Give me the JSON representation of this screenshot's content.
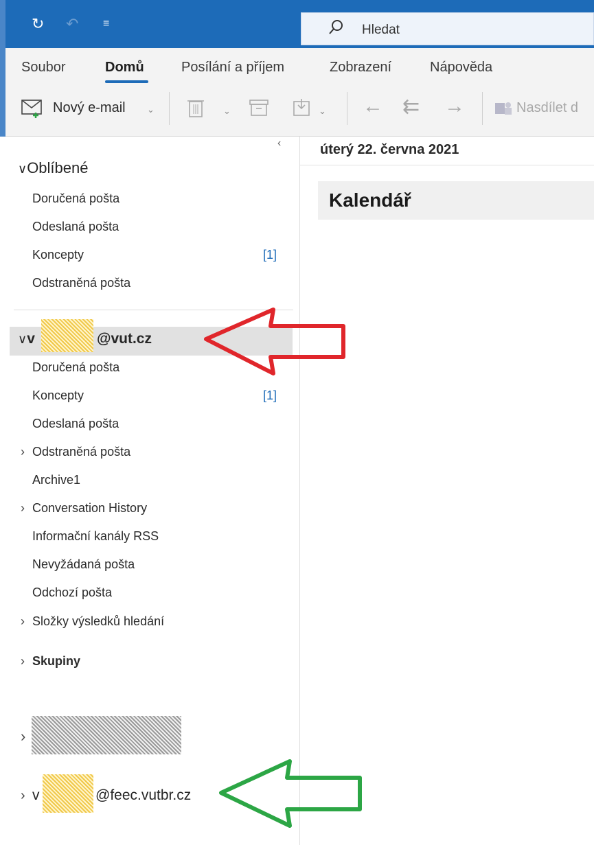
{
  "search": {
    "placeholder": "Hledat"
  },
  "ribbon": {
    "tabs": [
      "Soubor",
      "Domů",
      "Posílání a příjem",
      "Zobrazení",
      "Nápověda"
    ],
    "active_tab": "Domů",
    "new_email": "Nový e-mail",
    "share": "Nasdílet d"
  },
  "favorites": {
    "header": "Oblíbené",
    "items": [
      {
        "label": "Doručená pošta"
      },
      {
        "label": "Odeslaná pošta"
      },
      {
        "label": "Koncepty",
        "count": "[1]"
      },
      {
        "label": "Odstraněná pošta"
      }
    ]
  },
  "account1": {
    "prefix": "v",
    "suffix": "@vut.cz",
    "items": [
      {
        "label": "Doručená pošta"
      },
      {
        "label": "Koncepty",
        "count": "[1]"
      },
      {
        "label": "Odeslaná pošta"
      },
      {
        "label": "Odstraněná pošta",
        "expandable": true
      },
      {
        "label": "Archive1"
      },
      {
        "label": "Conversation History",
        "expandable": true
      },
      {
        "label": "Informační kanály RSS"
      },
      {
        "label": "Nevyžádaná pošta"
      },
      {
        "label": "Odchozí pošta"
      },
      {
        "label": "Složky výsledků hledání",
        "expandable": true
      }
    ],
    "groups": "Skupiny"
  },
  "account3": {
    "prefix": "v",
    "suffix": "@feec.vutbr.cz"
  },
  "reading": {
    "date": "úterý 22. června 2021",
    "calendar_title": "Kalendář"
  },
  "colors": {
    "titlebar": "#1d6bb8",
    "accent": "#1d6bb8",
    "red_arrow": "#e0262b",
    "green_arrow": "#2ca645"
  }
}
